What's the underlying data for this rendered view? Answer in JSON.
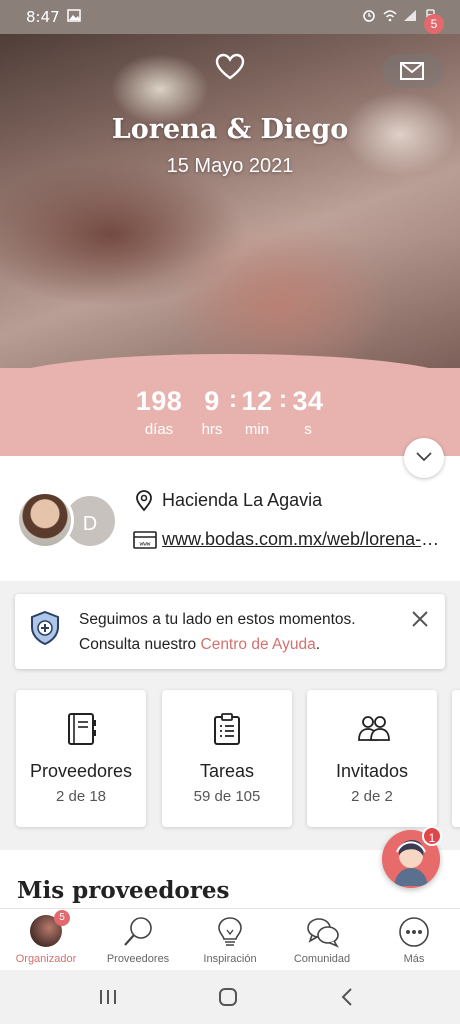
{
  "status_bar": {
    "time": "8:47"
  },
  "header": {
    "couple_names": "Lorena & Diego",
    "wedding_date": "15 Mayo 2021",
    "mail_badge_count": "5"
  },
  "countdown": {
    "days": "198",
    "days_label": "días",
    "hours": "9",
    "hours_label": "hrs",
    "minutes": "12",
    "minutes_label": "min",
    "seconds": "34",
    "seconds_label": "s"
  },
  "event": {
    "partner_initial": "D",
    "venue": "Hacienda La Agavia",
    "website": "www.bodas.com.mx/web/lorena-y-diego"
  },
  "notice": {
    "line1": "Seguimos a tu lado en estos momentos.",
    "line2_prefix": "Consulta nuestro ",
    "link_text": "Centro de Ayuda",
    "line2_suffix": "."
  },
  "cards": [
    {
      "title": "Proveedores",
      "subtitle": "2 de 18",
      "icon": "address-book-icon"
    },
    {
      "title": "Tareas",
      "subtitle": "59 de 105",
      "icon": "clipboard-list-icon"
    },
    {
      "title": "Invitados",
      "subtitle": "2 de 2",
      "icon": "guests-icon"
    }
  ],
  "section": {
    "title": "Mis proveedores"
  },
  "assistant": {
    "badge": "1"
  },
  "bottom_nav": {
    "organizer": {
      "label": "Organizador",
      "badge": "5"
    },
    "vendors": {
      "label": "Proveedores"
    },
    "inspiration": {
      "label": "Inspiración"
    },
    "community": {
      "label": "Comunidad"
    },
    "more": {
      "label": "Más"
    }
  },
  "colors": {
    "accent": "#d4706f",
    "countdown_band": "#e8b3ae",
    "badge": "#e26a6e"
  }
}
